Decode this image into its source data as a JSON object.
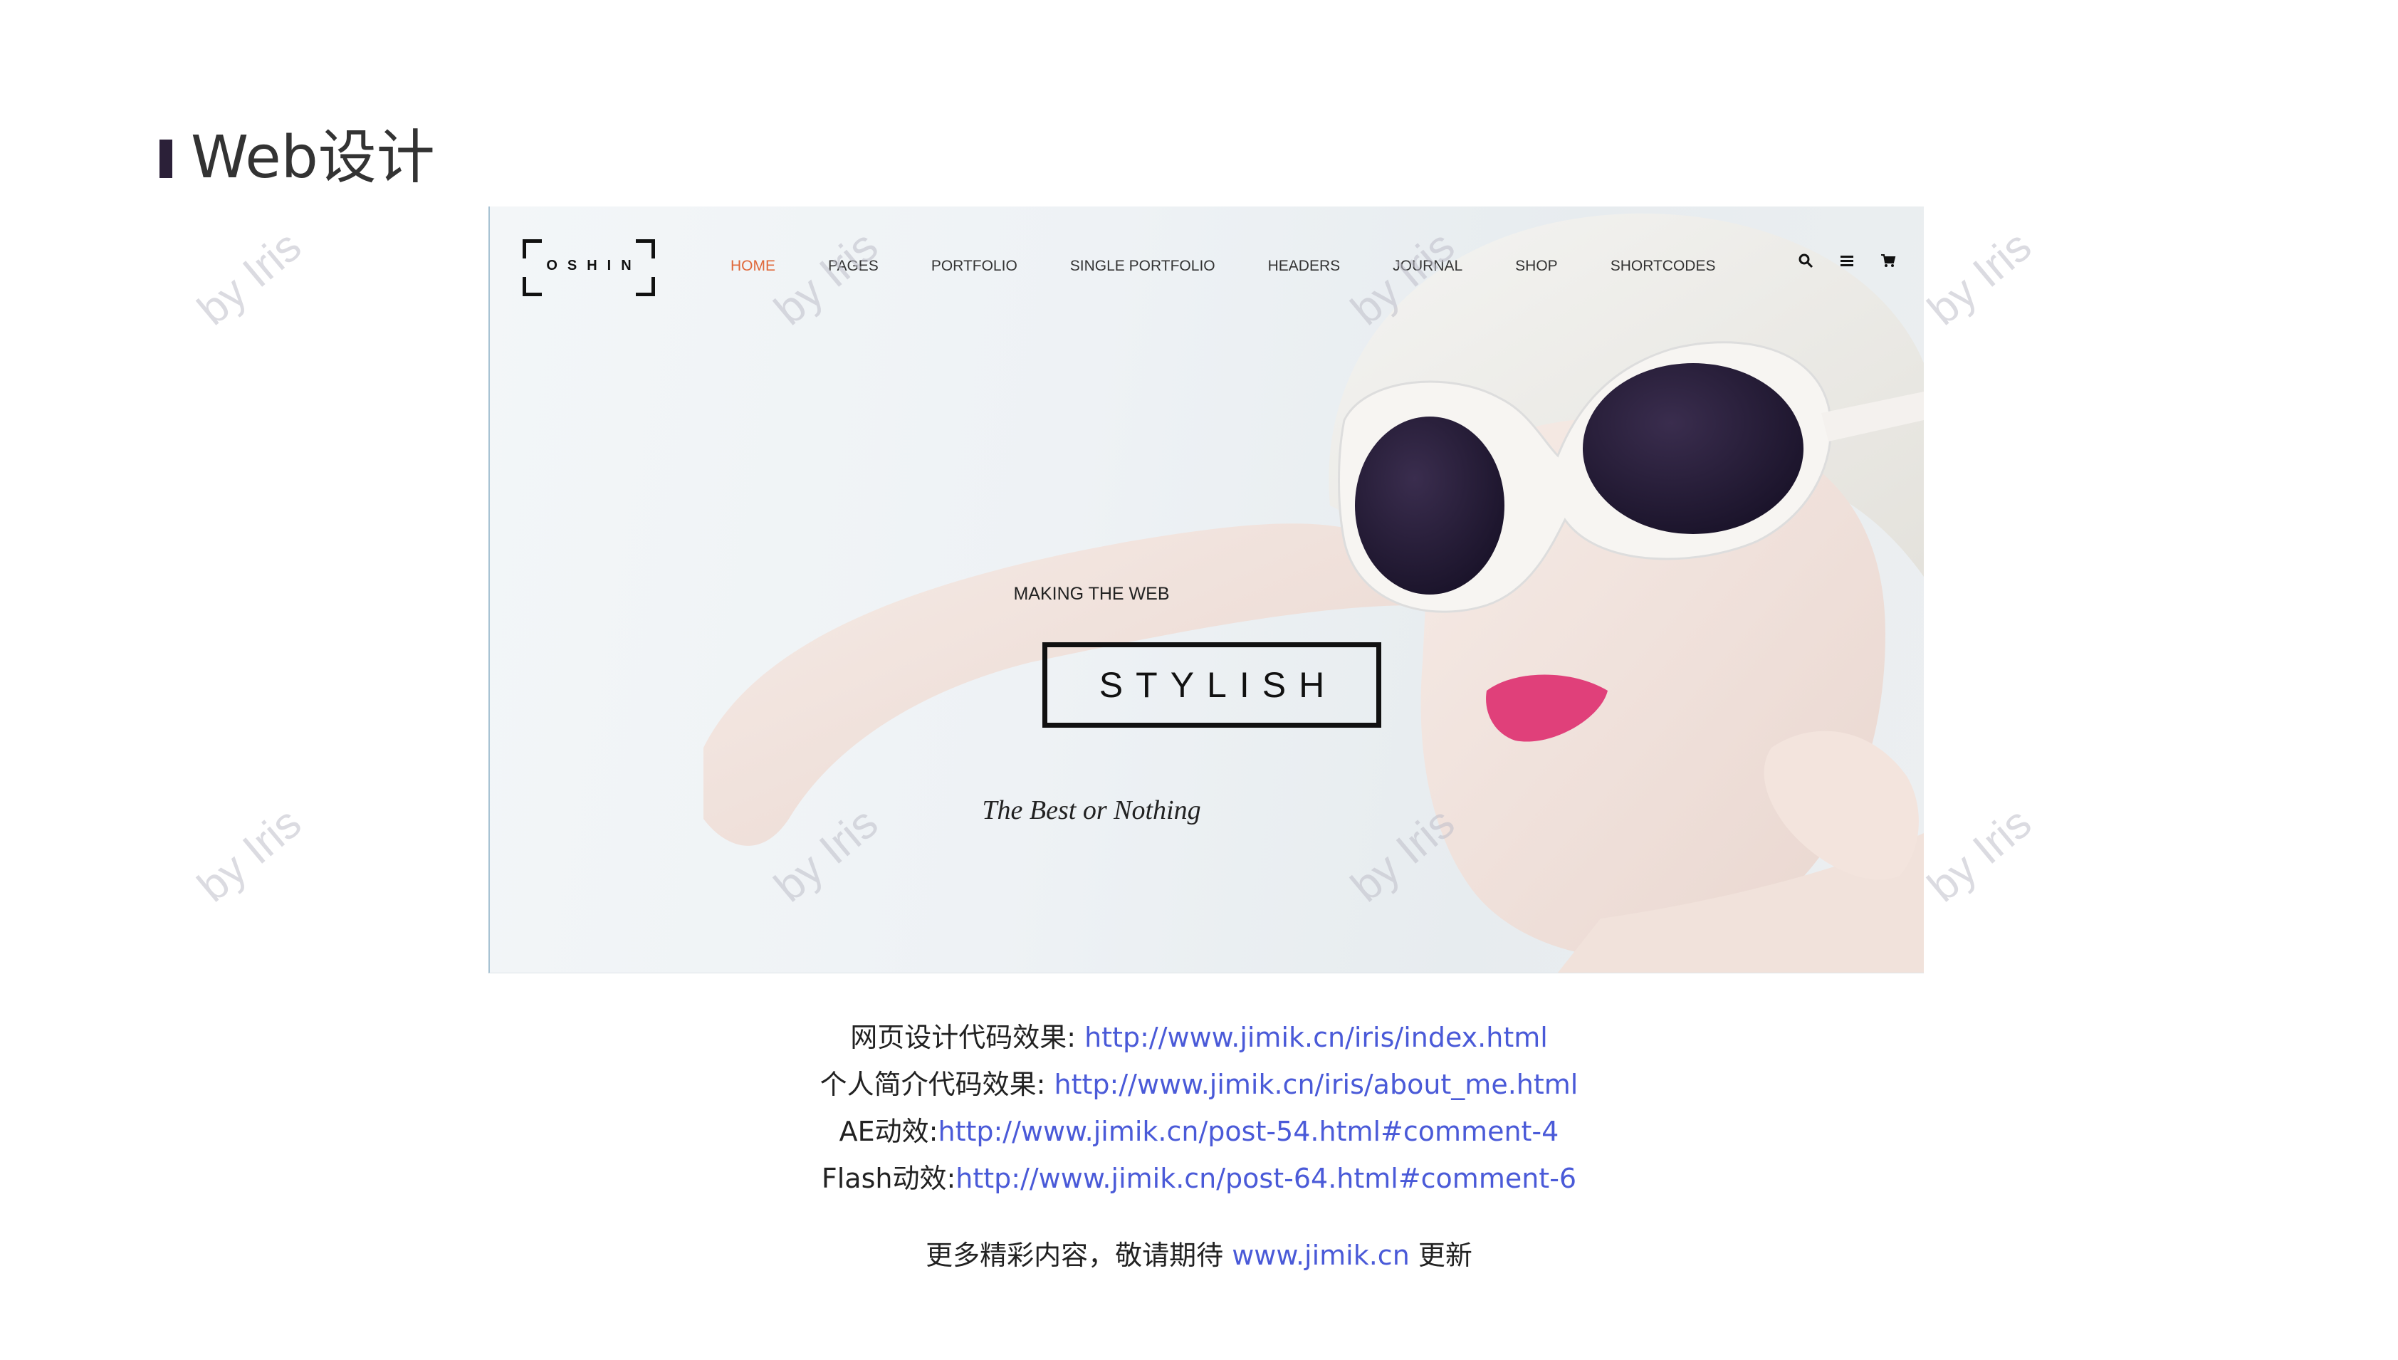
{
  "slide": {
    "title": "Web设计",
    "watermark": "by Iris"
  },
  "site": {
    "logo": "OSHIN",
    "nav": [
      "HOME",
      "PAGES",
      "PORTFOLIO",
      "SINGLE PORTFOLIO",
      "HEADERS",
      "JOURNAL",
      "SHOP",
      "SHORTCODES"
    ],
    "active_nav": "HOME",
    "icons": [
      "search-icon",
      "menu-icon",
      "cart-icon"
    ],
    "hero_pre": "MAKING THE WEB",
    "hero_title": "STYLISH",
    "hero_tagline": "The Best or Nothing",
    "accent_color": "#e0683a"
  },
  "links": [
    {
      "label": "网页设计代码效果: ",
      "url": "http://www.jimik.cn/iris/index.html"
    },
    {
      "label": "个人简介代码效果: ",
      "url": "http://www.jimik.cn/iris/about_me.html"
    },
    {
      "label": "AE动效:",
      "url": "http://www.jimik.cn/post-54.html#comment-4"
    },
    {
      "label": "Flash动效:",
      "url": "http://www.jimik.cn/post-64.html#comment-6"
    }
  ],
  "footer": {
    "prefix": "更多精彩内容，敬请期待 ",
    "url": "www.jimik.cn",
    "suffix": " 更新"
  },
  "link_color": "#4a5ad8"
}
